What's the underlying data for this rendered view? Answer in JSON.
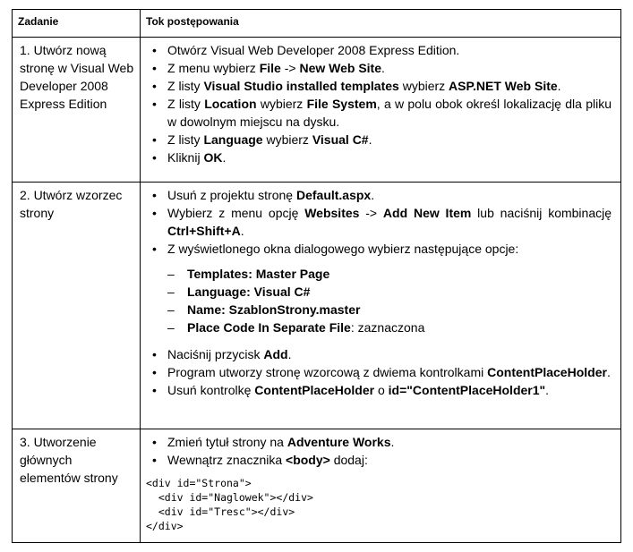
{
  "header": {
    "col1": "Zadanie",
    "col2": "Tok postępowania"
  },
  "rows": [
    {
      "task": "1.  Utwórz nową stronę w Visual Web Developer 2008 Express Edition",
      "steps": [
        [
          {
            "t": "Otwórz Visual Web Developer 2008 Express Edition."
          }
        ],
        [
          {
            "t": "Z menu wybierz "
          },
          {
            "t": "File",
            "b": true
          },
          {
            "t": " -> "
          },
          {
            "t": "New Web Site",
            "b": true
          },
          {
            "t": "."
          }
        ],
        [
          {
            "t": "Z listy "
          },
          {
            "t": "Visual Studio installed templates",
            "b": true
          },
          {
            "t": " wybierz "
          },
          {
            "t": "ASP.NET Web Site",
            "b": true
          },
          {
            "t": "."
          }
        ],
        [
          {
            "t": "Z listy "
          },
          {
            "t": "Location",
            "b": true
          },
          {
            "t": " wybierz "
          },
          {
            "t": "File System",
            "b": true
          },
          {
            "t": ", a w polu obok określ lokalizację dla pliku w dowolnym miejscu na dysku."
          }
        ],
        [
          {
            "t": "Z listy "
          },
          {
            "t": "Language",
            "b": true
          },
          {
            "t": " wybierz "
          },
          {
            "t": "Visual C#",
            "b": true
          },
          {
            "t": "."
          }
        ],
        [
          {
            "t": "Kliknij "
          },
          {
            "t": "OK",
            "b": true
          },
          {
            "t": "."
          }
        ]
      ]
    },
    {
      "task": "2.  Utwórz wzorzec strony",
      "steps": [
        [
          {
            "t": "Usuń z projektu stronę "
          },
          {
            "t": "Default.aspx",
            "b": true
          },
          {
            "t": "."
          }
        ],
        [
          {
            "t": "Wybierz z menu opcję "
          },
          {
            "t": "Websites",
            "b": true
          },
          {
            "t": " -> "
          },
          {
            "t": "Add New Item",
            "b": true
          },
          {
            "t": " lub naciśnij kombinację "
          },
          {
            "t": "Ctrl+Shift+A",
            "b": true
          },
          {
            "t": "."
          }
        ],
        [
          {
            "t": "Z wyświetlonego okna dialogowego wybierz następujące opcje:"
          }
        ],
        [
          {
            "t": "Naciśnij przycisk "
          },
          {
            "t": "Add",
            "b": true
          },
          {
            "t": "."
          }
        ],
        [
          {
            "t": "Program utworzy stronę wzorcową z dwiema kontrolkami "
          },
          {
            "t": "ContentPlaceHolder",
            "b": true
          },
          {
            "t": "."
          }
        ],
        [
          {
            "t": "Usuń kontrolkę "
          },
          {
            "t": "ContentPlaceHolder",
            "b": true
          },
          {
            "t": " o "
          },
          {
            "t": "id=\"ContentPlaceHolder1\"",
            "b": true
          },
          {
            "t": "."
          }
        ]
      ],
      "sub_after_index": 2,
      "subitems": [
        [
          {
            "t": "Templates: Master Page",
            "b": true
          }
        ],
        [
          {
            "t": "Language: Visual C#",
            "b": true
          }
        ],
        [
          {
            "t": "Name: SzablonStrony.master",
            "b": true
          }
        ],
        [
          {
            "t": "Place Code In Separate File",
            "b": true
          },
          {
            "t": ": zaznaczona"
          }
        ]
      ]
    },
    {
      "task": "3.  Utworzenie głównych elementów strony",
      "steps": [
        [
          {
            "t": "Zmień tytuł strony na "
          },
          {
            "t": "Adventure Works",
            "b": true
          },
          {
            "t": "."
          }
        ],
        [
          {
            "t": "Wewnątrz znacznika "
          },
          {
            "t": "<body>",
            "b": true
          },
          {
            "t": " dodaj:"
          }
        ]
      ],
      "code": "<div id=\"Strona\">\n  <div id=\"Naglowek\"></div>\n  <div id=\"Tresc\"></div>\n</div>"
    }
  ]
}
